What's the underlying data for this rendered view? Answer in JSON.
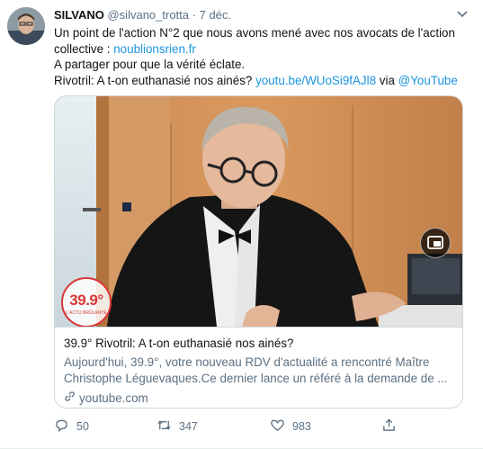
{
  "tweet": {
    "author_name": "SILVANO",
    "author_handle": "@silvano_trotta",
    "separator": "·",
    "date": "7 déc.",
    "lines": {
      "line1": "Un point de l'action N°2 que nous avons mené avec nos avocats de l'action",
      "line2_text": "collective : ",
      "line2_link": "noublionsrien.fr",
      "line3": "A partager pour que la vérité éclate.",
      "line4_text": "Rivotril: A t-on euthanasié nos ainés? ",
      "line4_link": "youtu.be/WUoSi9fAJl8",
      "line4_via": " via ",
      "line4_mention": "@YouTube"
    },
    "card": {
      "thumbnail_badge": "39.9°",
      "thumbnail_badge_sub": "L'ACTU BRÛLANTE",
      "title": "39.9° Rivotril: A t-on euthanasié nos ainés?",
      "description_line1": "Aujourd'hui, 39.9°, votre nouveau RDV d'actualité a rencontré Maître",
      "description_line2": "Christophe Léguevaques.Ce dernier lance un référé à la demande de ...",
      "domain": "youtube.com"
    },
    "actions": {
      "replies": "50",
      "retweets": "347",
      "likes": "983"
    }
  },
  "colors": {
    "link": "#1b95e0",
    "muted": "#5b7083",
    "border": "#cfd9de",
    "badge_red": "#d93636"
  },
  "icons": [
    "avatar",
    "chevron-down-icon",
    "pip-icon",
    "link-icon",
    "reply-icon",
    "retweet-icon",
    "like-icon",
    "share-icon"
  ]
}
